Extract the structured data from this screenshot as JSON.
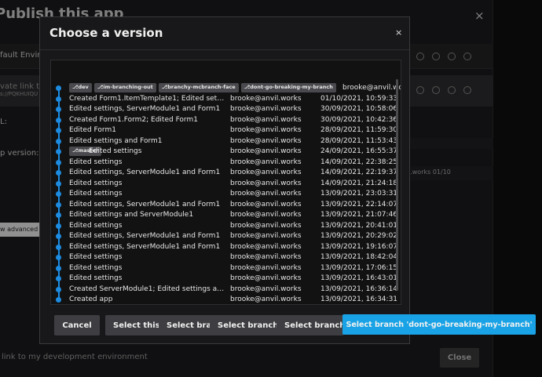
{
  "background": {
    "title": "Publish this app",
    "panel_label": "fault Enviro",
    "private_link_label": "vate link to",
    "private_link_sub": "s://PQKHUIQU",
    "url_label": "L:",
    "app_version_label": "p version:",
    "strip_text": "l.works      01/10",
    "advanced_label": "w advanced",
    "bottom_text": "link to my development environment",
    "close_label": "Close"
  },
  "modal": {
    "title": "Choose a version",
    "close_symbol": "×",
    "commits": [
      {
        "tags": [
          "dev",
          "im-branching-out",
          "branchy-mcbranch-face",
          "dont-go-breaking-my-branch"
        ],
        "message": "",
        "author": "brooke@anvil.works",
        "date": ""
      },
      {
        "tags": [],
        "message": "Created Form1.ItemTemplate1; Edited settings",
        "author": "brooke@anvil.works",
        "date": "01/10/2021, 10:59:33"
      },
      {
        "tags": [],
        "message": "Edited settings, ServerModule1 and Form1",
        "author": "brooke@anvil.works",
        "date": "30/09/2021, 10:58:06"
      },
      {
        "tags": [],
        "message": "Created Form1.Form2; Edited Form1",
        "author": "brooke@anvil.works",
        "date": "30/09/2021, 10:42:36"
      },
      {
        "tags": [],
        "message": "Edited Form1",
        "author": "brooke@anvil.works",
        "date": "28/09/2021, 11:59:30"
      },
      {
        "tags": [],
        "message": "Edited settings and Form1",
        "author": "brooke@anvil.works",
        "date": "28/09/2021, 11:53:43"
      },
      {
        "tags": [
          "master"
        ],
        "message": "Edited settings",
        "author": "brooke@anvil.works",
        "date": "24/09/2021, 16:55:37"
      },
      {
        "tags": [],
        "message": "Edited settings",
        "author": "brooke@anvil.works",
        "date": "14/09/2021, 22:38:25"
      },
      {
        "tags": [],
        "message": "Edited settings, ServerModule1 and Form1",
        "author": "brooke@anvil.works",
        "date": "14/09/2021, 22:19:37"
      },
      {
        "tags": [],
        "message": "Edited settings",
        "author": "brooke@anvil.works",
        "date": "14/09/2021, 21:24:18"
      },
      {
        "tags": [],
        "message": "Edited settings",
        "author": "brooke@anvil.works",
        "date": "13/09/2021, 23:03:31"
      },
      {
        "tags": [],
        "message": "Edited settings, ServerModule1 and Form1",
        "author": "brooke@anvil.works",
        "date": "13/09/2021, 22:14:07"
      },
      {
        "tags": [],
        "message": "Edited settings and ServerModule1",
        "author": "brooke@anvil.works",
        "date": "13/09/2021, 21:07:46"
      },
      {
        "tags": [],
        "message": "Edited settings",
        "author": "brooke@anvil.works",
        "date": "13/09/2021, 20:41:01"
      },
      {
        "tags": [],
        "message": "Edited settings, ServerModule1 and Form1",
        "author": "brooke@anvil.works",
        "date": "13/09/2021, 20:29:02"
      },
      {
        "tags": [],
        "message": "Edited settings, ServerModule1 and Form1",
        "author": "brooke@anvil.works",
        "date": "13/09/2021, 19:16:07"
      },
      {
        "tags": [],
        "message": "Edited settings",
        "author": "brooke@anvil.works",
        "date": "13/09/2021, 18:42:04"
      },
      {
        "tags": [],
        "message": "Edited settings",
        "author": "brooke@anvil.works",
        "date": "13/09/2021, 17:06:15"
      },
      {
        "tags": [],
        "message": "Edited settings",
        "author": "brooke@anvil.works",
        "date": "13/09/2021, 16:43:01"
      },
      {
        "tags": [],
        "message": "Created ServerModule1; Edited settings and Form1",
        "author": "brooke@anvil.works",
        "date": "13/09/2021, 16:36:14"
      },
      {
        "tags": [],
        "message": "Created app",
        "author": "brooke@anvil.works",
        "date": "13/09/2021, 16:34:31"
      }
    ]
  },
  "footer": {
    "cancel_label": "Cancel",
    "select_commit_label": "Select this c",
    "select_branch_1_label": "Select bran",
    "select_branch_2_label": "Select branch 'i",
    "select_branch_3_label": "Select branch 'b",
    "select_branch_primary_label": "Select branch 'dont-go-breaking-my-branch'"
  },
  "colors": {
    "accent": "#19a3e6",
    "timeline": "#1c8be0",
    "modal_bg": "#18181a"
  }
}
